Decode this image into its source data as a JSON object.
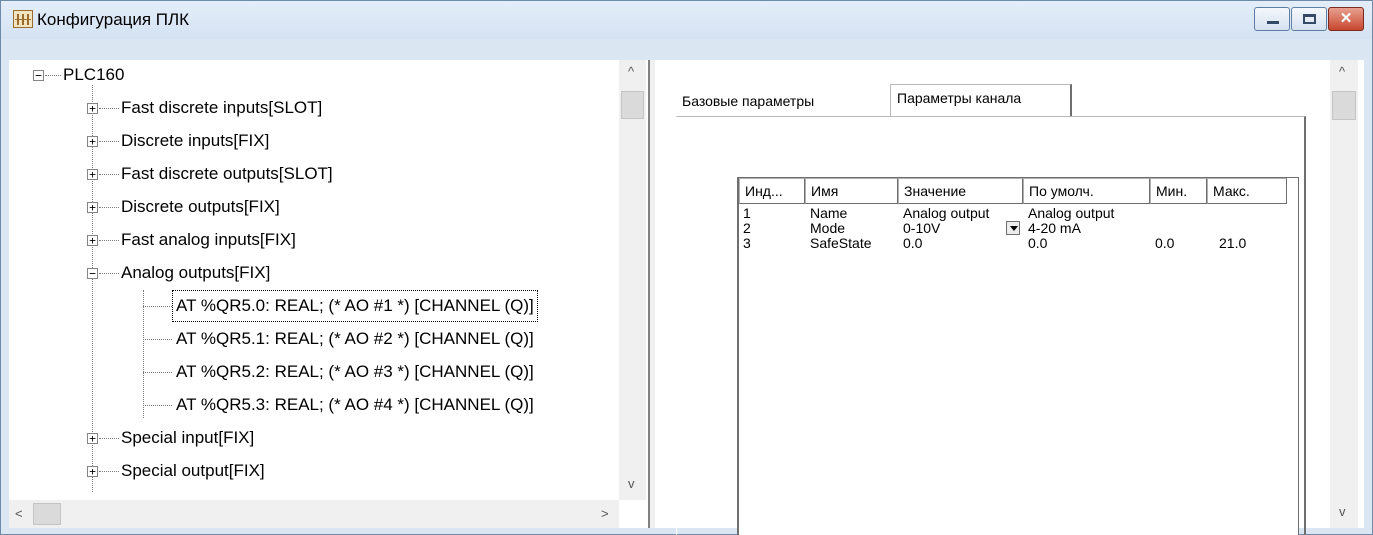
{
  "window": {
    "title": "Конфигурация ПЛК",
    "icon": "plc-config-icon",
    "close_glyph": "✕"
  },
  "tree": {
    "root": "PLC160",
    "expander_collapsed": "+",
    "expander_expanded": "−",
    "items": [
      {
        "label": "Fast discrete inputs[SLOT]",
        "expanded": false
      },
      {
        "label": "Discrete inputs[FIX]",
        "expanded": false
      },
      {
        "label": "Fast discrete outputs[SLOT]",
        "expanded": false
      },
      {
        "label": "Discrete outputs[FIX]",
        "expanded": false
      },
      {
        "label": "Fast analog inputs[FIX]",
        "expanded": false
      },
      {
        "label": "Analog outputs[FIX]",
        "expanded": true
      },
      {
        "label": "Special input[FIX]",
        "expanded": false
      },
      {
        "label": "Special output[FIX]",
        "expanded": false
      }
    ],
    "channels": [
      "AT %QR5.0: REAL; (* AO #1 *) [CHANNEL (Q)]",
      "AT %QR5.1: REAL; (* AO #2 *) [CHANNEL (Q)]",
      "AT %QR5.2: REAL; (* AO #3 *) [CHANNEL (Q)]",
      "AT %QR5.3: REAL; (* AO #4 *) [CHANNEL (Q)]"
    ]
  },
  "scroll": {
    "up": "^",
    "down": "v",
    "left": "<",
    "right": ">"
  },
  "tabs": [
    {
      "label": "Базовые параметры",
      "active": false
    },
    {
      "label": "Параметры канала",
      "active": true
    }
  ],
  "grid": {
    "headers": [
      "Инд...",
      "Имя",
      "Значение",
      "По умолч.",
      "Мин.",
      "Макс."
    ],
    "rows": [
      [
        "1",
        "Name",
        "Analog output",
        "Analog output",
        "",
        ""
      ],
      [
        "2",
        "Mode",
        "0-10V",
        "4-20 mA",
        "",
        ""
      ],
      [
        "3",
        "SafeState",
        "0.0",
        "0.0",
        "0.0",
        "21.0"
      ]
    ]
  }
}
